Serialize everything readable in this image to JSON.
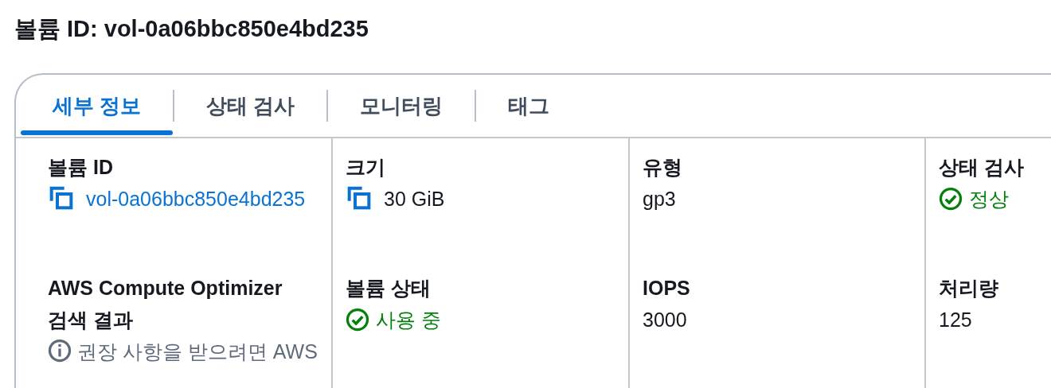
{
  "title": "볼륨 ID: vol-0a06bbc850e4bd235",
  "tabs": [
    {
      "label": "세부 정보",
      "selected": true
    },
    {
      "label": "상태 검사",
      "selected": false
    },
    {
      "label": "모니터링",
      "selected": false
    },
    {
      "label": "태그",
      "selected": false
    }
  ],
  "columns": [
    {
      "fields": [
        {
          "label": "볼륨 ID",
          "kind": "copy-link",
          "value": "vol-0a06bbc850e4bd235"
        },
        {
          "label": "AWS Compute Optimizer 검색 결과",
          "kind": "info",
          "value": "권장 사항을 받으려면 AWS"
        }
      ]
    },
    {
      "fields": [
        {
          "label": "크기",
          "kind": "copy",
          "value": "30 GiB"
        },
        {
          "label": "볼륨 상태",
          "kind": "status",
          "value": "사용 중"
        }
      ]
    },
    {
      "fields": [
        {
          "label": "유형",
          "kind": "text",
          "value": "gp3"
        },
        {
          "label": "IOPS",
          "kind": "text",
          "value": "3000"
        }
      ]
    },
    {
      "fields": [
        {
          "label": "상태 검사",
          "kind": "status",
          "value": "정상"
        },
        {
          "label": "처리량",
          "kind": "text",
          "value": "125"
        }
      ]
    }
  ]
}
